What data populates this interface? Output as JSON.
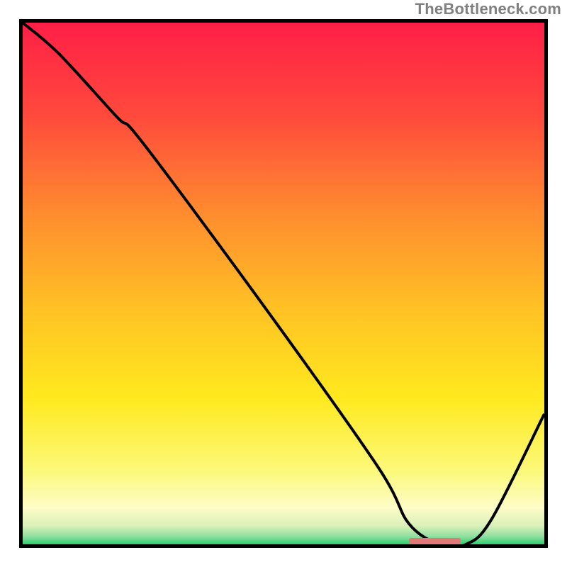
{
  "watermark": {
    "text": "TheBottleneck.com"
  },
  "chart_data": {
    "type": "line",
    "title": "",
    "xlabel": "",
    "ylabel": "",
    "xlim": [
      0,
      100
    ],
    "ylim": [
      0,
      100
    ],
    "grid": false,
    "legend": false,
    "background_gradient": {
      "type": "vertical",
      "stops": [
        {
          "pos": 0.0,
          "color": "#ff1f47"
        },
        {
          "pos": 0.18,
          "color": "#ff4a3c"
        },
        {
          "pos": 0.36,
          "color": "#ff8a2f"
        },
        {
          "pos": 0.55,
          "color": "#ffc224"
        },
        {
          "pos": 0.72,
          "color": "#ffe91e"
        },
        {
          "pos": 0.86,
          "color": "#fcf97a"
        },
        {
          "pos": 0.93,
          "color": "#fdfcc7"
        },
        {
          "pos": 0.965,
          "color": "#d9f0b8"
        },
        {
          "pos": 0.985,
          "color": "#8fdf9f"
        },
        {
          "pos": 1.0,
          "color": "#2ecf6f"
        }
      ]
    },
    "series": [
      {
        "name": "bottleneck-curve",
        "color": "#000000",
        "x": [
          0,
          7,
          18,
          23,
          46,
          68,
          74,
          80,
          85,
          90,
          100
        ],
        "y": [
          100,
          94,
          82,
          77,
          46,
          15,
          4,
          0,
          0,
          5,
          25
        ]
      }
    ],
    "marker": {
      "comment": "small pink dashed band at curve minimum",
      "x_start": 74,
      "x_end": 84,
      "y": 0,
      "color": "#e07a78"
    }
  }
}
